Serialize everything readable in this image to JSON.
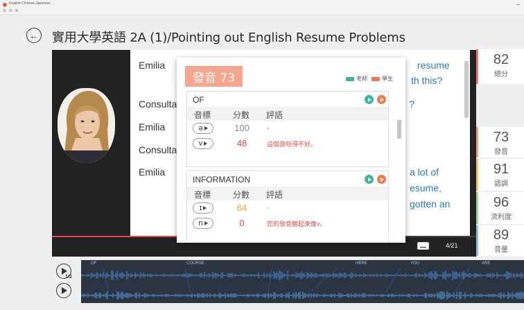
{
  "window": {
    "title": "English-Chinese-Japanese",
    "controls": "⊖ ⊖ ⊖",
    "minimize": "–"
  },
  "header": {
    "title": "實用大學英語 2A (1)/Pointing out English Resume Problems"
  },
  "script": {
    "rows": [
      {
        "speaker": "Emilia"
      },
      {
        "speaker": "Consulta"
      },
      {
        "speaker": "Emilia"
      },
      {
        "speaker": "Consulta"
      },
      {
        "speaker": "Emilia"
      }
    ],
    "fragments": [
      "resume",
      "th this?",
      "?",
      "a lot of",
      "esume,",
      "gotten an"
    ]
  },
  "status": {
    "page": "4/21",
    "progress": 0.3
  },
  "scores": [
    {
      "value": "82",
      "label": "總分",
      "color": "#e07a6a"
    },
    {
      "value": "73",
      "label": "發音",
      "color": "#f2a07f"
    },
    {
      "value": "91",
      "label": "語調",
      "color": "#f3c46a"
    },
    {
      "value": "96",
      "label": "流利度",
      "color": "#9fd39c"
    },
    {
      "value": "89",
      "label": "音量",
      "color": "#8fc0e8"
    }
  ],
  "popup": {
    "badge": "發音 73",
    "legend": {
      "teacher": "老師",
      "student": "學生",
      "teacher_color": "#3bb5a1",
      "student_color": "#f07a4d"
    },
    "columns": {
      "phonetic": "音標",
      "score": "分數",
      "comment": "評語"
    },
    "sections": [
      {
        "word": "OF",
        "rows": [
          {
            "phonetic": "ə",
            "score": "100",
            "comment": "-",
            "score_color": "#888888"
          },
          {
            "phonetic": "v",
            "score": "48",
            "comment": "這個音唸得不好。",
            "score_color": "#e04a4a"
          }
        ]
      },
      {
        "word": "INFORMATION",
        "rows": [
          {
            "phonetic": "ɪ",
            "score": "64",
            "comment": "-",
            "score_color": "#f0a030"
          },
          {
            "phonetic": "n",
            "score": "0",
            "comment": "您的發音聽起來像v。",
            "score_color": "#e04a4a"
          }
        ]
      }
    ]
  },
  "waveform": {
    "labels": [
      "OF",
      "COURSE",
      "HERE",
      "YOU",
      "ARE"
    ],
    "speed_label": "1/2"
  }
}
